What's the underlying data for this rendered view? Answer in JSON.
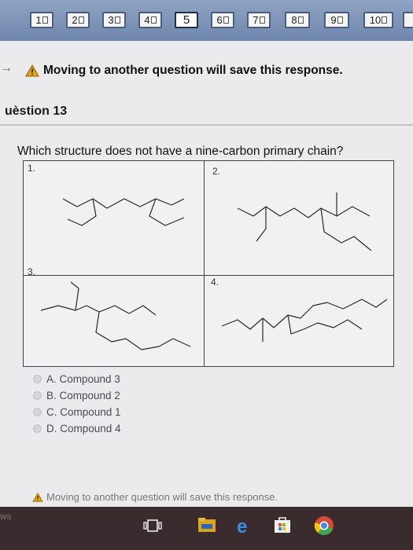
{
  "nav": {
    "buttons": [
      {
        "label": "1"
      },
      {
        "label": "2"
      },
      {
        "label": "3"
      },
      {
        "label": "4"
      },
      {
        "label": "5",
        "current": true
      },
      {
        "label": "6"
      },
      {
        "label": "7"
      },
      {
        "label": "8"
      },
      {
        "label": "9"
      },
      {
        "label": "10"
      }
    ]
  },
  "warning_top": "Moving to another question will save this response.",
  "question": {
    "heading": "uèstion 13",
    "text": "Which structure does not have a nine-carbon primary chain?",
    "cells": [
      "1.",
      "2.",
      "3.",
      "4."
    ]
  },
  "options": [
    {
      "label": "A. Compound 3"
    },
    {
      "label": "B. Compound 2"
    },
    {
      "label": "C. Compound 1"
    },
    {
      "label": "D. Compound 4"
    }
  ],
  "warning_bottom": "Moving to another question will save this response.",
  "taskbar": {
    "label": "WS"
  },
  "colors": {
    "nav": "#7b90b6",
    "warning": "#e8a21a",
    "taskbar": "#3a2c2e"
  },
  "icons": [
    "arrow-icon",
    "warning-icon",
    "page-icon",
    "task-view-icon",
    "file-explorer-icon",
    "edge-icon",
    "store-icon",
    "chrome-icon"
  ]
}
